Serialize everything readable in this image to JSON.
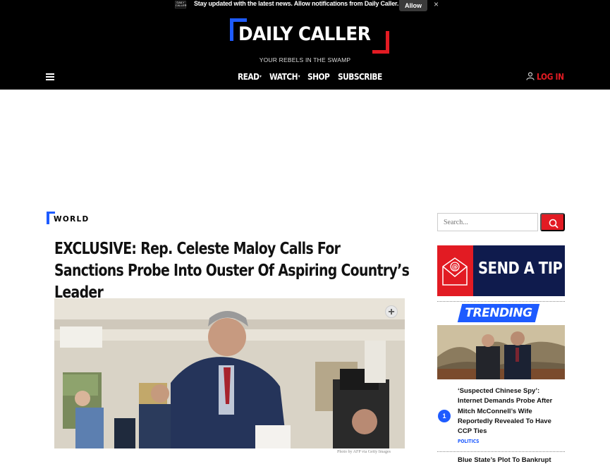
{
  "notification": {
    "logo_text": "DAILY CALLER",
    "message": "Stay updated with the latest news. Allow notifications from Daily Caller.",
    "allow_label": "Allow",
    "close_glyph": "×"
  },
  "header": {
    "logo_text": "DAILY CALLER",
    "tagline": "YOUR REBELS IN THE SWAMP",
    "nav": [
      {
        "label": "READ",
        "caret": "▾"
      },
      {
        "label": "WATCH",
        "caret": "▾"
      },
      {
        "label": "SHOP",
        "caret": ""
      },
      {
        "label": "SUBSCRIBE",
        "caret": ""
      }
    ],
    "login_label": "LOG IN",
    "menu_icon": "hamburger-icon",
    "user_icon": "user-icon"
  },
  "article": {
    "section": "WORLD",
    "headline": "EXCLUSIVE: Rep. Celeste Maloy Calls For Sanctions Probe Into Ouster Of Aspiring Country’s Leader",
    "photo_credit": "Photo by AFP via Getty Images",
    "expand_glyph": "+"
  },
  "sidebar": {
    "search_placeholder": "Search...",
    "search_icon": "search-icon",
    "tip_label": "SEND A TIP",
    "tip_icon": "email-icon",
    "trending_label": "TRENDING",
    "trending": [
      {
        "rank": "1",
        "title": "‘Suspected Chinese Spy’: Internet Demands Probe After Mitch McConnell’s Wife Reportedly Revealed To Have CCP Ties",
        "category": "POLITICS"
      },
      {
        "title": "Blue State’s Plot To Bankrupt"
      }
    ]
  },
  "colors": {
    "accent_blue": "#1e5bff",
    "accent_red": "#e21b23",
    "navy": "#0f1b4d",
    "header_bg": "#000000"
  }
}
